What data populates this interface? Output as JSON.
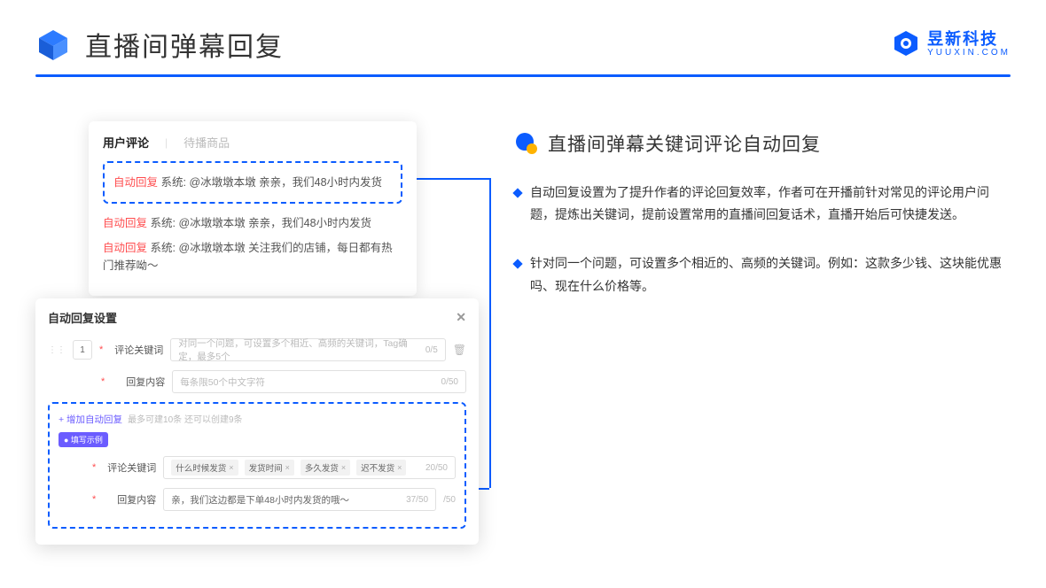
{
  "header": {
    "title": "直播间弹幕回复",
    "brand_name": "昱新科技",
    "brand_sub": "YUUXIN.COM"
  },
  "panel1": {
    "tab_active": "用户评论",
    "tab_inactive": "待播商品",
    "auto_badge": "自动回复",
    "system_label": "系统:",
    "msg1": "@冰墩墩本墩 亲亲，我们48小时内发货",
    "msg2": "@冰墩墩本墩 亲亲，我们48小时内发货",
    "msg3": "@冰墩墩本墩 关注我们的店铺，每日都有热门推荐呦～"
  },
  "panel2": {
    "title": "自动回复设置",
    "idx": "1",
    "label_keyword": "评论关键词",
    "kw_placeholder": "对同一个问题，可设置多个相近、高频的关键词，Tag确定，最多5个",
    "kw_counter": "0/5",
    "label_reply": "回复内容",
    "reply_placeholder": "每条限50个中文字符",
    "reply_counter": "0/50",
    "add_link": "+ 增加自动回复",
    "add_hint": "最多可建10条 还可以创建9条",
    "example_badge": "● 填写示例",
    "ex_tag1": "什么时候发货",
    "ex_tag2": "发货时间",
    "ex_tag3": "多久发货",
    "ex_tag4": "迟不发货",
    "ex_kw_counter": "20/50",
    "ex_reply_text": "亲，我们这边都是下单48小时内发货的哦～",
    "ex_reply_counter": "37/50",
    "extra_counter": "/50"
  },
  "right": {
    "title": "直播间弹幕关键词评论自动回复",
    "bullet1": "自动回复设置为了提升作者的评论回复效率，作者可在开播前针对常见的评论用户问题，提炼出关键词，提前设置常用的直播间回复话术，直播开始后可快捷发送。",
    "bullet2": "针对同一个问题，可设置多个相近的、高频的关键词。例如：这款多少钱、这块能优惠吗、现在什么价格等。"
  }
}
